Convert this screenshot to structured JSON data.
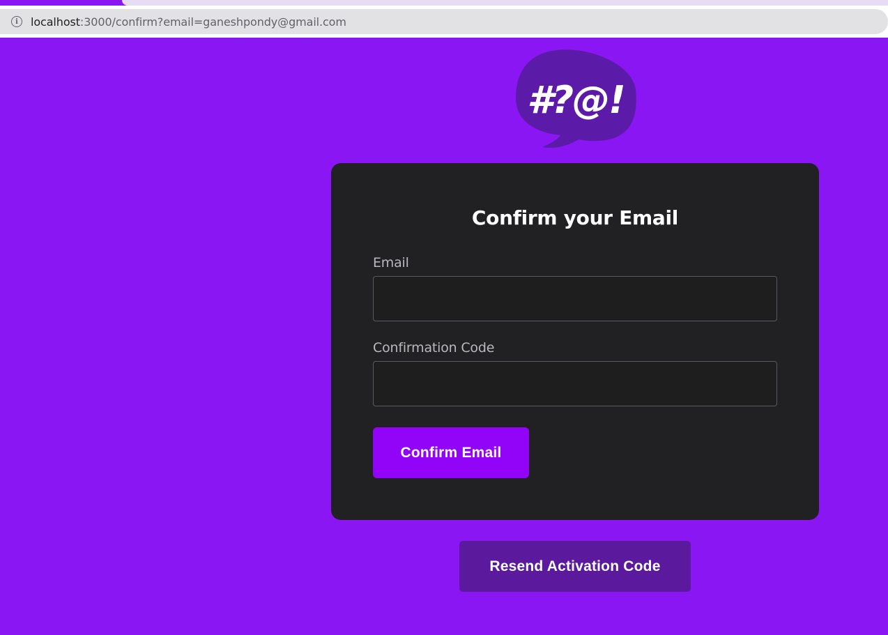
{
  "browser": {
    "url_host": "localhost",
    "url_rest": ":3000/confirm?email=ganeshpondy@gmail.com",
    "info_icon_glyph": "i"
  },
  "logo": {
    "text": "#?@!",
    "bubble_color": "#5b1ba8"
  },
  "form": {
    "title": "Confirm your Email",
    "email_label": "Email",
    "email_value": "",
    "code_label": "Confirmation Code",
    "code_value": "",
    "confirm_button": "Confirm Email"
  },
  "resend_button": "Resend Activation Code",
  "colors": {
    "page_background": "#8a17f3",
    "card_background": "#212124",
    "primary_button": "#9104f7",
    "secondary_button": "#5b1a9e"
  }
}
